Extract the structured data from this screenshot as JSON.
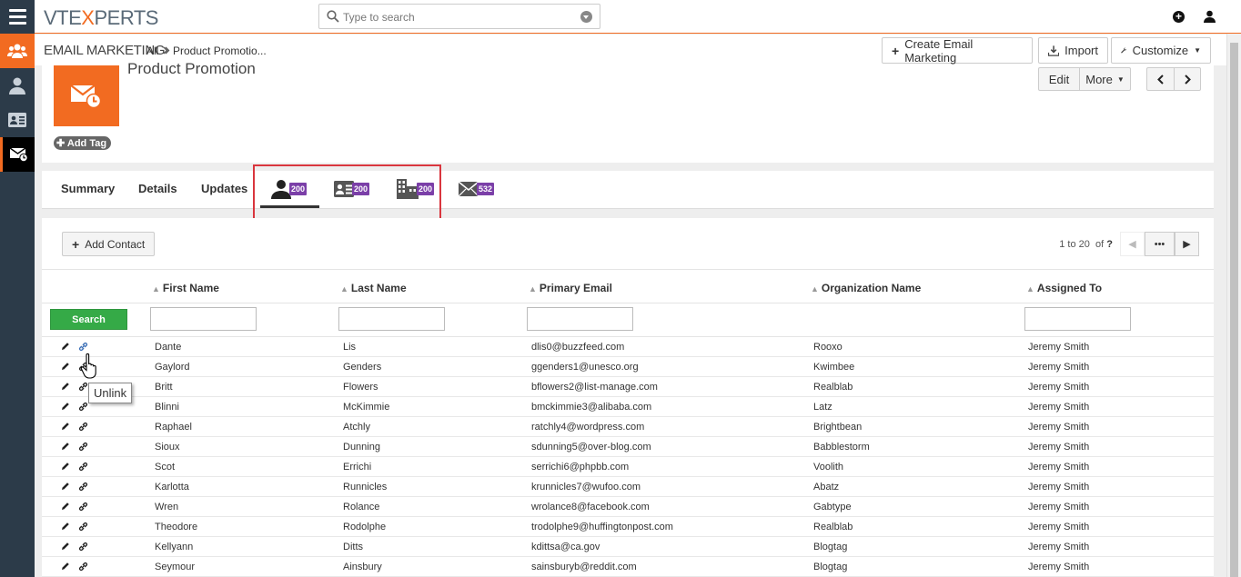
{
  "app": {
    "logo_left": "VTE",
    "logo_x": "X",
    "logo_right": "PERTS",
    "search_placeholder": "Type to search"
  },
  "module": {
    "name": "EMAIL MARKETING",
    "crumb_all": "All",
    "crumb_record": "Product Promotio...",
    "create_label": "Create Email Marketing",
    "import_label": "Import",
    "customize_label": "Customize"
  },
  "record": {
    "title": "Product Promotion",
    "add_tag": "Add Tag",
    "edit_label": "Edit",
    "more_label": "More"
  },
  "tabs": {
    "summary": "Summary",
    "details": "Details",
    "updates": "Updates",
    "contacts_count": "200",
    "leads_count": "200",
    "accounts_count": "200",
    "emails_count": "532"
  },
  "related": {
    "add_contact": "Add Contact",
    "pager_text": "1 to 20",
    "pager_of": "of",
    "pager_total": "?",
    "pager_more": "•••",
    "search_button": "Search",
    "columns": [
      "First Name",
      "Last Name",
      "Primary Email",
      "Organization Name",
      "Assigned To"
    ],
    "rows": [
      [
        "Dante",
        "Lis",
        "dlis0@buzzfeed.com",
        "Rooxo",
        "Jeremy Smith"
      ],
      [
        "Gaylord",
        "Genders",
        "ggenders1@unesco.org",
        "Kwimbee",
        "Jeremy Smith"
      ],
      [
        "Britt",
        "Flowers",
        "bflowers2@list-manage.com",
        "Realblab",
        "Jeremy Smith"
      ],
      [
        "Blinni",
        "McKimmie",
        "bmckimmie3@alibaba.com",
        "Latz",
        "Jeremy Smith"
      ],
      [
        "Raphael",
        "Atchly",
        "ratchly4@wordpress.com",
        "Brightbean",
        "Jeremy Smith"
      ],
      [
        "Sioux",
        "Dunning",
        "sdunning5@over-blog.com",
        "Babblestorm",
        "Jeremy Smith"
      ],
      [
        "Scot",
        "Errichi",
        "serrichi6@phpbb.com",
        "Voolith",
        "Jeremy Smith"
      ],
      [
        "Karlotta",
        "Runnicles",
        "krunnicles7@wufoo.com",
        "Abatz",
        "Jeremy Smith"
      ],
      [
        "Wren",
        "Rolance",
        "wrolance8@facebook.com",
        "Gabtype",
        "Jeremy Smith"
      ],
      [
        "Theodore",
        "Rodolphe",
        "trodolphe9@huffingtonpost.com",
        "Realblab",
        "Jeremy Smith"
      ],
      [
        "Kellyann",
        "Ditts",
        "kdittsa@ca.gov",
        "Blogtag",
        "Jeremy Smith"
      ],
      [
        "Seymour",
        "Ainsbury",
        "sainsburyb@reddit.com",
        "Blogtag",
        "Jeremy Smith"
      ]
    ]
  },
  "tooltip": "Unlink",
  "colors": {
    "accent": "#f26b21",
    "badge": "#7b3fa8",
    "search_button": "#35aa47",
    "rail": "#2c3b49",
    "highlight_box": "#d9363e"
  }
}
